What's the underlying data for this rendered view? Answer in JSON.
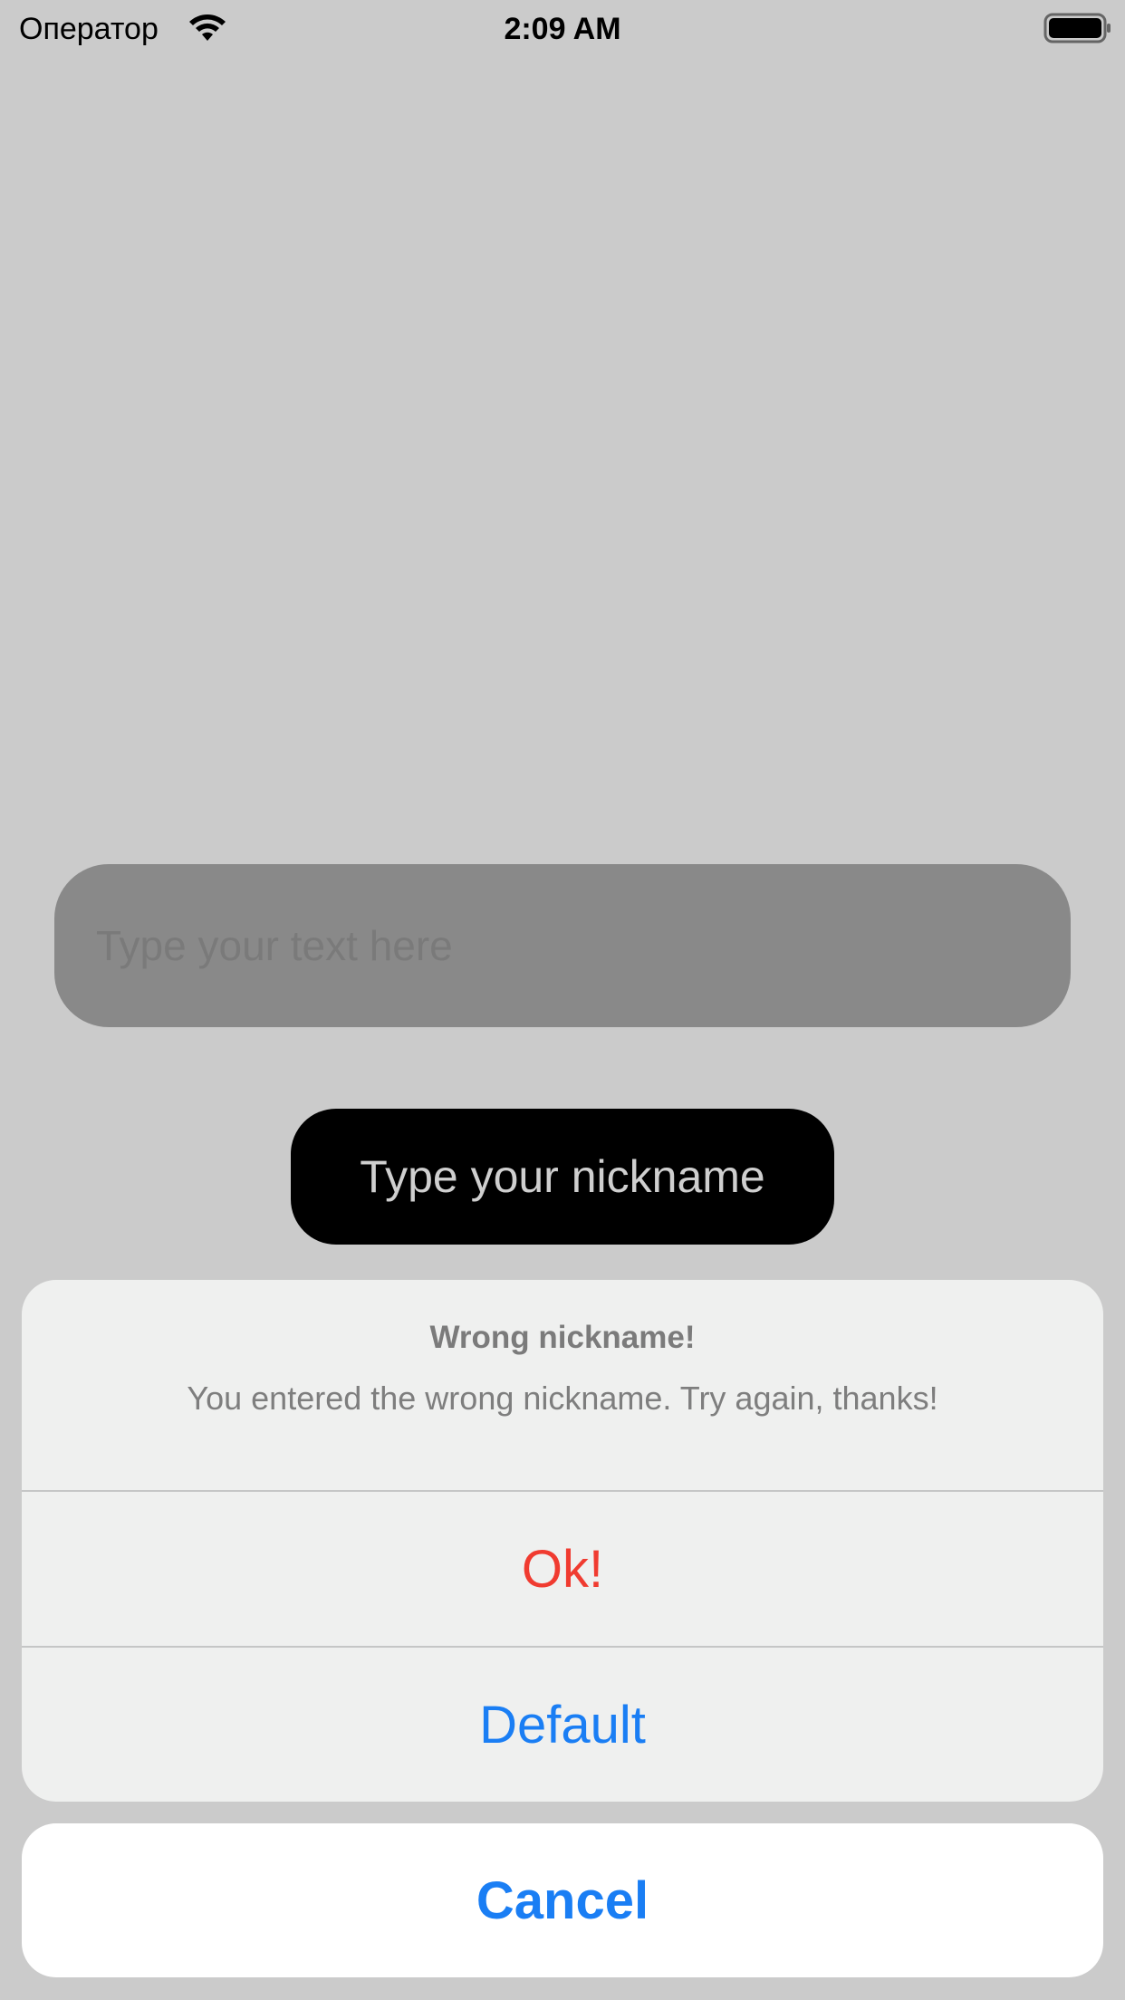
{
  "status_bar": {
    "carrier": "Оператор",
    "time": "2:09 AM",
    "wifi_icon": "wifi-icon",
    "battery_icon": "battery-icon"
  },
  "main": {
    "text_field": {
      "placeholder": "Type your text here",
      "value": ""
    },
    "nickname_button_label": "Type your nickname"
  },
  "alert": {
    "title": "Wrong nickname!",
    "message": "You entered the wrong nickname. Try again, thanks!",
    "actions": [
      {
        "label": "Ok!",
        "style": "destructive",
        "color": "#f03b30"
      },
      {
        "label": "Default",
        "style": "default",
        "color": "#1a7ef4"
      }
    ],
    "cancel_label": "Cancel"
  },
  "colors": {
    "background": "#cbcbcb",
    "accent": "#1a7ef4",
    "destructive": "#f03b30"
  }
}
